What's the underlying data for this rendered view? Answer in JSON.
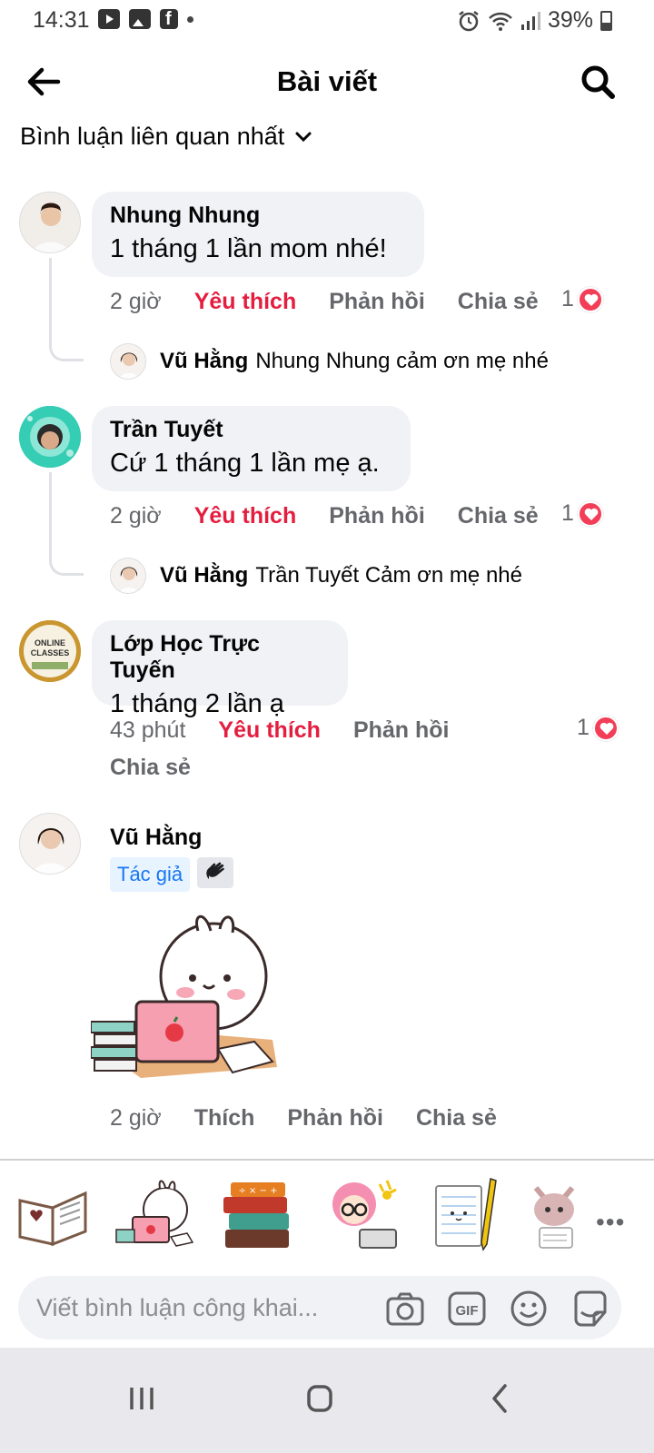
{
  "status_bar": {
    "time": "14:31",
    "battery": "39%",
    "left_icons": [
      "youtube-icon",
      "gallery-icon",
      "facebook-icon",
      "dot-icon"
    ],
    "right_icons": [
      "alarm-icon",
      "wifi-icon",
      "signal-icon",
      "battery-icon"
    ]
  },
  "header": {
    "title": "Bài viết",
    "back_icon": "arrow-left-icon",
    "search_icon": "search-icon"
  },
  "sort": {
    "label": "Bình luận liên quan nhất",
    "icon": "chevron-down-icon"
  },
  "comments": [
    {
      "author": "Nhung Nhung",
      "text": "1 tháng 1 lần mom nhé!",
      "time": "2 giờ",
      "like_label": "Yêu thích",
      "reply_label": "Phản hồi",
      "share_label": "Chia sẻ",
      "reaction_count": "1",
      "reply": {
        "author": "Vũ Hằng",
        "text": "Nhung Nhung cảm ơn mẹ nhé"
      }
    },
    {
      "author": "Trần Tuyết",
      "text": "Cứ 1 tháng 1 lần mẹ ạ.",
      "time": "2 giờ",
      "like_label": "Yêu thích",
      "reply_label": "Phản hồi",
      "share_label": "Chia sẻ",
      "reaction_count": "1",
      "reply": {
        "author": "Vũ Hằng",
        "text": "Trần Tuyết Cảm ơn mẹ nhé"
      }
    },
    {
      "author": "Lớp Học Trực Tuyến",
      "avatar_text": "ONLINE CLASSES",
      "text": "1 tháng 2 lần ạ",
      "time": "43 phút",
      "like_label": "Yêu thích",
      "reply_label": "Phản hồi",
      "share_label": "Chia sẻ",
      "reaction_count": "1"
    },
    {
      "author": "Vũ Hằng",
      "badge": "Tác giả",
      "time": "2 giờ",
      "like_label": "Thích",
      "reply_label": "Phản hồi",
      "share_label": "Chia sẻ"
    }
  ],
  "stickers": [
    "open-book-sticker",
    "bunny-laptop-sticker",
    "books-stack-sticker",
    "girl-laptop-sticker",
    "notepad-pencil-sticker",
    "cat-writing-sticker"
  ],
  "composer": {
    "placeholder": "Viết bình luận công khai...",
    "icons": [
      "camera-icon",
      "gif-icon",
      "emoji-icon",
      "sticker-icon"
    ]
  },
  "nav": [
    "recents-icon",
    "home-icon",
    "back-icon"
  ],
  "colors": {
    "liked": "#e41e3f",
    "bubble": "#f0f2f5",
    "secondary_text": "#65676b",
    "author_badge_bg": "#e7f3ff",
    "author_badge_text": "#1877f2"
  }
}
